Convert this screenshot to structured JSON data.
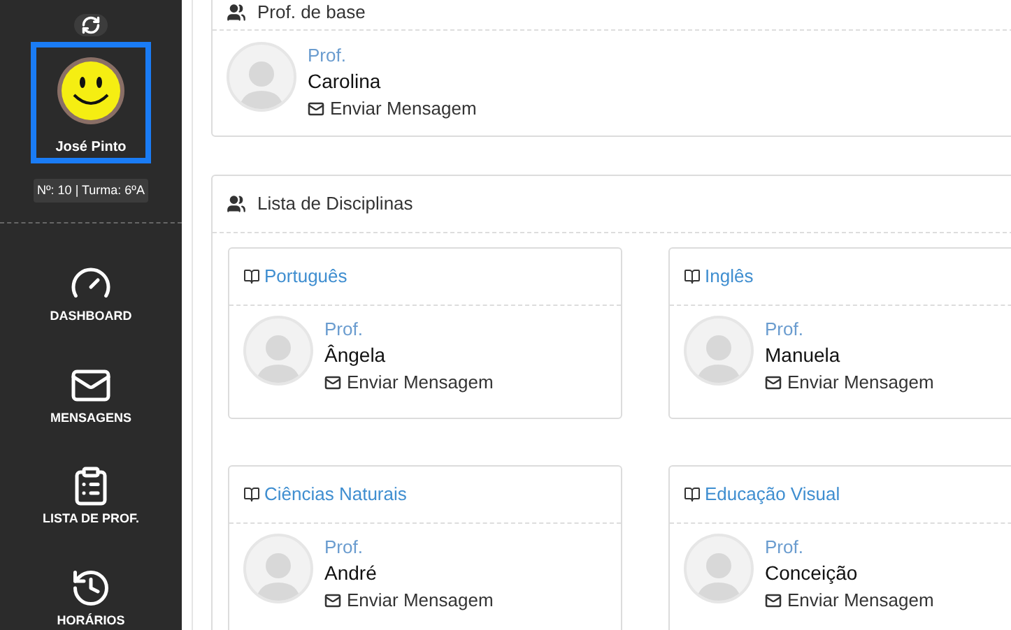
{
  "sidebar": {
    "profile_name": "José Pinto",
    "badge": "Nº: 10 | Turma: 6ºA",
    "nav": [
      {
        "kind": "dashboard",
        "label": "DASHBOARD"
      },
      {
        "kind": "messages",
        "label": "MENSAGENS"
      },
      {
        "kind": "teachers",
        "label": "LISTA DE PROF."
      },
      {
        "kind": "schedule",
        "label": "HORÁRIOS"
      }
    ]
  },
  "base_panel": {
    "title": "Prof. de base",
    "teacher": {
      "label": "Prof.",
      "name": "Carolina",
      "action": "Enviar Mensagem"
    }
  },
  "disciplines_panel": {
    "title": "Lista de Disciplinas",
    "subjects": [
      {
        "name": "Português",
        "teacher": {
          "label": "Prof.",
          "name": "Ângela",
          "action": "Enviar Mensagem"
        }
      },
      {
        "name": "Inglês",
        "teacher": {
          "label": "Prof.",
          "name": "Manuela",
          "action": "Enviar Mensagem"
        }
      },
      {
        "name": "Ciências Naturais",
        "teacher": {
          "label": "Prof.",
          "name": "André",
          "action": "Enviar Mensagem"
        }
      },
      {
        "name": "Educação Visual",
        "teacher": {
          "label": "Prof.",
          "name": "Conceição",
          "action": "Enviar Mensagem"
        }
      }
    ]
  }
}
